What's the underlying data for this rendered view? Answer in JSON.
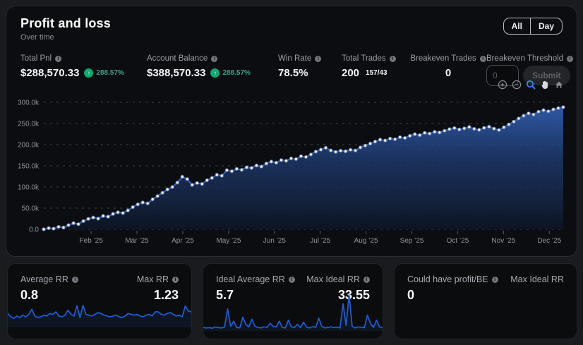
{
  "header": {
    "title": "Profit and loss",
    "subtitle": "Over time",
    "range": [
      "All",
      "Day"
    ]
  },
  "stats": [
    {
      "label": "Total Pnl",
      "value": "$288,570.33",
      "badge": "288.57%"
    },
    {
      "label": "Account Balance",
      "value": "$388,570.33",
      "badge": "288.57%"
    },
    {
      "label": "Win Rate",
      "value": "78.5%"
    },
    {
      "label": "Total Trades",
      "value": "200",
      "sup": "157/43"
    },
    {
      "label": "Breakeven Trades",
      "value": "0"
    },
    {
      "label": "Breakeven Threshold",
      "input_placeholder": "0",
      "submit_label": "Submit"
    }
  ],
  "toolbar": {
    "icons": [
      "zoom-in-icon",
      "zoom-out-icon",
      "selection-zoom-icon",
      "pan-hand-icon",
      "reset-home-icon"
    ],
    "active": "selection-zoom-icon"
  },
  "colors": {
    "accent_blue": "#2e63cd",
    "toolbar_active_blue": "#3b82f6",
    "positive_green": "#10a971",
    "badge_text_green": "#3aa184",
    "panel_bg": "#0c0d10",
    "page_bg": "#1a1b1e",
    "marker_fill": "#eef1f7",
    "grid_line": "#3f4248"
  },
  "chart_data": {
    "type": "area",
    "title": "Profit and loss",
    "subtitle": "Over time",
    "xlabel": "",
    "ylabel": "",
    "grid": "dashed-horizontal",
    "legend": "none",
    "ylim": [
      0,
      300000
    ],
    "y_tick_labels": [
      "300.0k",
      "250.0k",
      "200.0k",
      "150.0k",
      "100.0k",
      "50.0k",
      "0.0"
    ],
    "x_labels": [
      "Feb ’25",
      "Mar ’25",
      "Apr ’25",
      "May ’25",
      "Jun ’25",
      "Jul ’25",
      "Aug ’25",
      "Sep ’25",
      "Oct ’25",
      "Nov ’25",
      "Dec ’25"
    ],
    "values": [
      0,
      2800,
      1500,
      5900,
      4200,
      9800,
      14500,
      12100,
      19400,
      24600,
      27800,
      25200,
      31500,
      29800,
      36400,
      40200,
      38500,
      44700,
      52300,
      58900,
      63400,
      61200,
      70800,
      78500,
      86300,
      94100,
      99800,
      110400,
      124200,
      118600,
      104900,
      109300,
      107100,
      115800,
      121400,
      128900,
      126500,
      139700,
      137200,
      142800,
      140500,
      146300,
      144900,
      150600,
      148200,
      155400,
      159800,
      157300,
      163500,
      161900,
      167400,
      165800,
      172600,
      170900,
      176800,
      183500,
      188200,
      192700,
      186400,
      182900,
      185600,
      184100,
      187900,
      186200,
      193400,
      197800,
      202500,
      207100,
      211600,
      209800,
      214300,
      212700,
      217500,
      215900,
      220800,
      224600,
      222300,
      227900,
      226100,
      230400,
      228700,
      232800,
      236500,
      239200,
      235600,
      238400,
      241700,
      237300,
      234800,
      239600,
      242300,
      237900,
      234500,
      240800,
      247600,
      254300,
      261800,
      268400,
      273900,
      271200,
      277800,
      281400,
      278600,
      283200,
      286100,
      288570.33
    ]
  },
  "cards": [
    {
      "left_label": "Average RR",
      "left_value": "0.8",
      "right_label": "Max RR",
      "right_value": "1.23",
      "spark": [
        0.75,
        0.55,
        0.45,
        0.6,
        0.5,
        0.65,
        0.55,
        0.7,
        1.0,
        0.6,
        0.5,
        0.55,
        0.65,
        0.6,
        0.75,
        0.7,
        0.85,
        0.6,
        0.55,
        0.65,
        0.95,
        0.7,
        0.6,
        1.21,
        0.5,
        1.23,
        0.7,
        0.65,
        0.6,
        0.7,
        0.8,
        0.75,
        0.65,
        0.6,
        0.55,
        0.6,
        0.65,
        0.55,
        0.5,
        0.6,
        0.75,
        0.7,
        0.65,
        0.7,
        0.6,
        0.55,
        0.65,
        0.7,
        0.6,
        0.85,
        0.85,
        0.7,
        0.65,
        0.75,
        0.8,
        0.7,
        0.6,
        0.65,
        0.55,
        1.2,
        0.9,
        0.85
      ]
    },
    {
      "left_label": "Ideal Average RR",
      "left_value": "5.7",
      "right_label": "Max Ideal RR",
      "right_value": "33.55",
      "spark": [
        2,
        1.5,
        1.8,
        1.2,
        2.5,
        1.8,
        1.5,
        2.2,
        20,
        3,
        8,
        2,
        1.5,
        12,
        5,
        2.5,
        10,
        3,
        2,
        1.5,
        2.5,
        2,
        6,
        3,
        2.5,
        8,
        2,
        1.5,
        9,
        2.5,
        2,
        5,
        1.8,
        7,
        2.2,
        1.5,
        2.8,
        2,
        11,
        3,
        1.5,
        2,
        2.5,
        1.8,
        2.2,
        1.5,
        25,
        4,
        33.55,
        3,
        1.5,
        2.5,
        2,
        1.8,
        14,
        6,
        2,
        9,
        2.5,
        1.8
      ]
    },
    {
      "left_label": "Could have profit/BE",
      "left_value": "0",
      "right_label": "Max Ideal RR",
      "right_value": "",
      "spark": []
    }
  ]
}
